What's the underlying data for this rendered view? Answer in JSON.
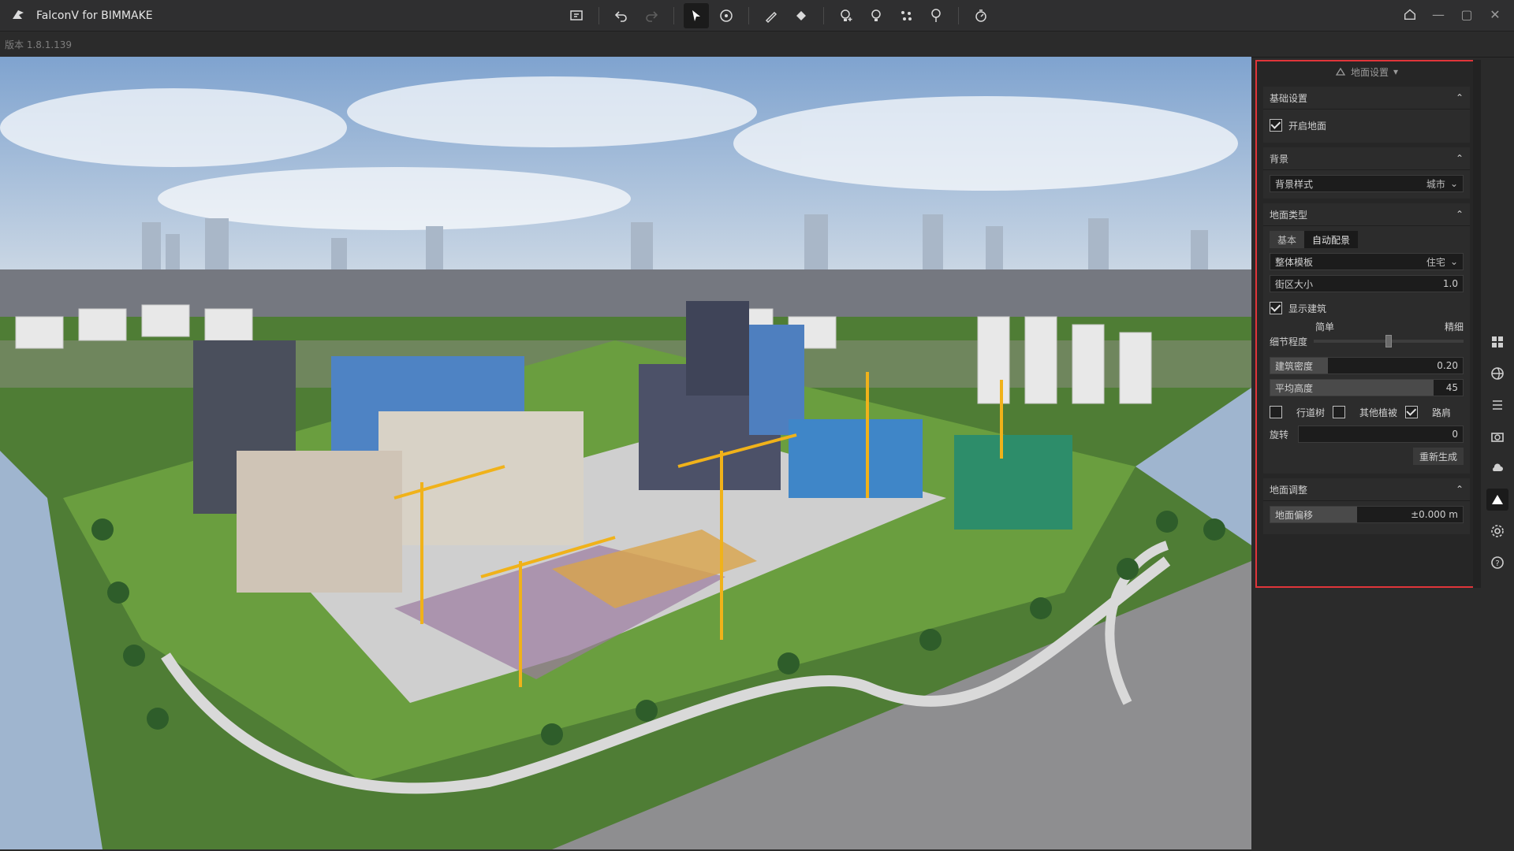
{
  "app": {
    "title": "FalconV for BIMMAKE",
    "version_label": "版本 1.8.1.139"
  },
  "toolbar": {
    "items": [
      "layout-icon",
      "undo-icon",
      "redo-icon",
      "pointer-icon",
      "orbit-icon",
      "pen-icon",
      "fill-icon",
      "add-bulb-icon",
      "bulb-icon",
      "scatter-icon",
      "tree-icon",
      "timer-icon"
    ]
  },
  "window": {
    "home_icon": "home-icon",
    "min": "—",
    "max": "▢",
    "close": "✕"
  },
  "panel": {
    "title": "地面设置",
    "sections": {
      "basic": {
        "title": "基础设置",
        "enable_ground": "开启地面",
        "enable_ground_checked": true
      },
      "background": {
        "title": "背景",
        "style_label": "背景样式",
        "style_value": "城市"
      },
      "ground_type": {
        "title": "地面类型",
        "tabs": [
          "基本",
          "自动配景"
        ],
        "active_tab": 1,
        "template_label": "整体模板",
        "template_value": "住宅",
        "block_size_label": "街区大小",
        "block_size_value": "1.0",
        "show_buildings": "显示建筑",
        "show_buildings_checked": true,
        "detail_simple": "简单",
        "detail_fine": "精细",
        "detail_label": "细节程度",
        "detail_level": 0.5,
        "density_label": "建筑密度",
        "density_value": "0.20",
        "density_fraction": 0.3,
        "height_label": "平均高度",
        "height_value": "45",
        "height_fraction": 0.85,
        "street_tree": "行道树",
        "street_tree_checked": false,
        "other_plants": "其他植被",
        "other_plants_checked": false,
        "road_shoulder": "路肩",
        "road_shoulder_checked": true,
        "rotation_label": "旋转",
        "rotation_value": "0",
        "regen_button": "重新生成"
      },
      "ground_adjust": {
        "title": "地面调整",
        "offset_label": "地面偏移",
        "offset_value": "±0.000 m",
        "offset_fraction": 0.45
      }
    }
  },
  "rightstrip": [
    "grid-icon",
    "globe-icon",
    "list-icon",
    "camera-icon",
    "weather-icon",
    "ground-icon",
    "settings-icon",
    "help-icon"
  ]
}
